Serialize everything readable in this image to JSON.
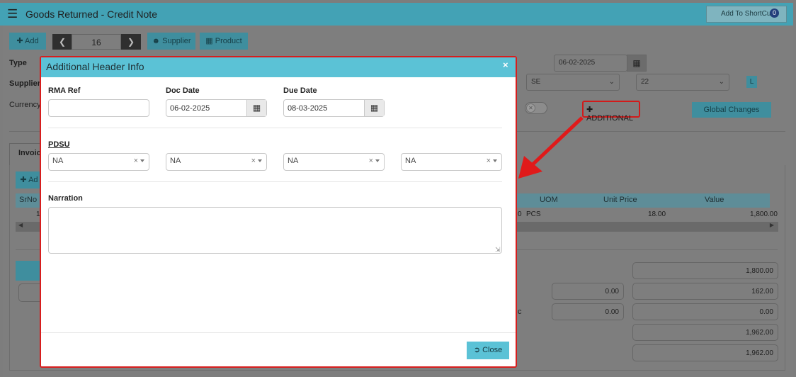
{
  "window": {
    "title": "Goods Returned - Credit Note",
    "shortcut_label": "Add To ShortCut",
    "shortcut_count": "0"
  },
  "toolbar": {
    "add_label": "Add",
    "page_number": "16",
    "supplier_label": "Supplier",
    "product_label": "Product"
  },
  "form": {
    "type_label": "Type",
    "supplier_label": "Supplier",
    "currency_label": "Currency",
    "date_value": "06-02-2025",
    "select_se": "SE",
    "select_22": "22",
    "l_badge": "L",
    "additional_label": "ADDITIONAL",
    "global_changes_label": "Global Changes"
  },
  "invoice": {
    "tab_label": "Invoic",
    "add_label": "Ad",
    "columns": [
      "SrNo",
      "UOM",
      "Unit Price",
      "Value"
    ],
    "row": {
      "srno": "1",
      "qty_tail": "0",
      "uom": "PCS",
      "unit_price": "18.00",
      "value": "1,800.00"
    }
  },
  "totals": {
    "left_inputs": [
      "0.00",
      "0.00"
    ],
    "right_values": [
      "1,800.00",
      "162.00",
      "0.00",
      "1,962.00",
      "1,962.00"
    ],
    "label_fragment": "c"
  },
  "modal": {
    "title": "Additional Header Info",
    "rma_ref_label": "RMA Ref",
    "rma_ref_value": "",
    "doc_date_label": "Doc Date",
    "doc_date_value": "06-02-2025",
    "due_date_label": "Due Date",
    "due_date_value": "08-03-2025",
    "pdsu_label": "PDSU",
    "pdsu_selects": [
      "NA",
      "NA",
      "NA",
      "NA"
    ],
    "narration_label": "Narration",
    "narration_value": "",
    "close_label": "Close"
  },
  "colors": {
    "accent": "#5bc2d6",
    "highlight": "#d71e1e",
    "overlay": "#7e7e7e"
  }
}
